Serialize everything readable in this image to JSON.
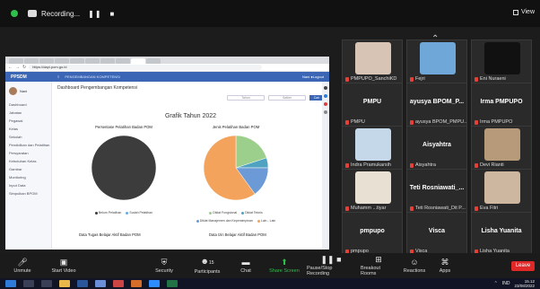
{
  "topbar": {
    "recording_label": "Recording...",
    "pause_label": "❚❚",
    "stop_label": "■",
    "view_label": "View"
  },
  "browser": {
    "url": "https://dapi.pom.go.id",
    "app_brand": "PPSDM",
    "app_header_crumb": "PENGEMBANGAN KOMPETENSI",
    "app_header_user": "Nani  ●Logout"
  },
  "sidebar": {
    "user_name": "Nani",
    "items": [
      {
        "label": "Dashboard"
      },
      {
        "label": "Jabatan"
      },
      {
        "label": "Pegawai"
      },
      {
        "label": "Kelas"
      },
      {
        "label": "Sekolah"
      },
      {
        "label": "Pendidikan dan Pelatihan"
      },
      {
        "label": "Persyaratan"
      },
      {
        "label": "Kebutuhan Kelas"
      },
      {
        "label": "Gambar"
      },
      {
        "label": "Monitoring"
      },
      {
        "label": "Input Data"
      },
      {
        "label": "Simpulkan BPOM"
      }
    ]
  },
  "main": {
    "breadcrumb": "Dashboard Pengembangan Kompetensi",
    "filter_1": "Tahun",
    "filter_2": "Satker",
    "filter_button": "Cari",
    "chart_heading": "Grafik Tahun 2022",
    "bottom_left_label": "Data Tugas Belajar Aktif Badan POM",
    "bottom_right_label": "Data Izin Belajar Aktif Badan POM"
  },
  "chart_data": [
    {
      "type": "pie",
      "title": "Persentase Pelatihan Badan POM",
      "categories": [
        "Belum Pelatihan",
        "Sudah Pelatihan"
      ],
      "values": [
        100,
        0
      ],
      "colors": [
        "#3c3c3c",
        "#6ba7e8"
      ],
      "legend": [
        "Belum Pelatihan",
        "Sudah Pelatihan"
      ]
    },
    {
      "type": "pie",
      "title": "Jenis Pelatihan Badan POM",
      "categories": [
        "Diklat Fungsional",
        "Diklat Teknis",
        "Diklat Manajemen dan Kepemimpinan",
        "Lain - Lain"
      ],
      "values": [
        20,
        5,
        15,
        60
      ],
      "colors": [
        "#9ccf8c",
        "#4fa2c0",
        "#6b9ad6",
        "#f3a35c"
      ],
      "legend": [
        "Diklat Fungsional",
        "Diklat Teknis",
        "Diklat Manajemen dan Kepemimpinan",
        "Lain - Lain"
      ]
    }
  ],
  "gallery": {
    "tiles": [
      {
        "name": "PMPUPO_SanchiKD",
        "big": "",
        "face_color": "#d8c4b4"
      },
      {
        "name": "Fejri",
        "big": "",
        "face_color": "#6fa8d8"
      },
      {
        "name": "Eni Nuraeni",
        "big": "",
        "face_color": "#111111"
      },
      {
        "name": "PMPU",
        "big": "PMPU",
        "face_color": ""
      },
      {
        "name": "ayusya BPOM_PMPU...",
        "big": "ayusya BPOM_P...",
        "face_color": ""
      },
      {
        "name": "Irma PMPUPO",
        "big": "Irma PMPUPO",
        "face_color": ""
      },
      {
        "name": "Indra Pramukarsih",
        "big": "",
        "face_color": "#c5d8ea"
      },
      {
        "name": "Aisyahtra",
        "big": "Aisyahtra",
        "face_color": ""
      },
      {
        "name": "Devi Rianti",
        "big": "",
        "face_color": "#b69a7a"
      },
      {
        "name": "Muhamm ...tiyar",
        "big": "",
        "face_color": "#e8e0d2"
      },
      {
        "name": "Teti Rosniawati_Dit P...",
        "big": "Teti Rosniawati_...",
        "face_color": ""
      },
      {
        "name": "Eva Fitri",
        "big": "",
        "face_color": "#cdb7a0"
      },
      {
        "name": "pmpupo",
        "big": "pmpupo",
        "face_color": ""
      },
      {
        "name": "Visca",
        "big": "Visca",
        "face_color": ""
      },
      {
        "name": "Lisha Yuanita",
        "big": "Lisha Yuanita",
        "face_color": ""
      }
    ]
  },
  "toolbar": {
    "unmute": "Unmute",
    "start_video": "Start Video",
    "security": "Security",
    "participants": "Participants",
    "participants_count": "15",
    "chat": "Chat",
    "share_screen": "Share Screen",
    "pause_recording": "Pause/Stop Recording",
    "breakout_rooms": "Breakout Rooms",
    "reactions": "Reactions",
    "apps": "Apps",
    "leave": "Leave"
  },
  "taskbar": {
    "language": "IND",
    "time": "15.12",
    "date": "23/08/2022"
  }
}
